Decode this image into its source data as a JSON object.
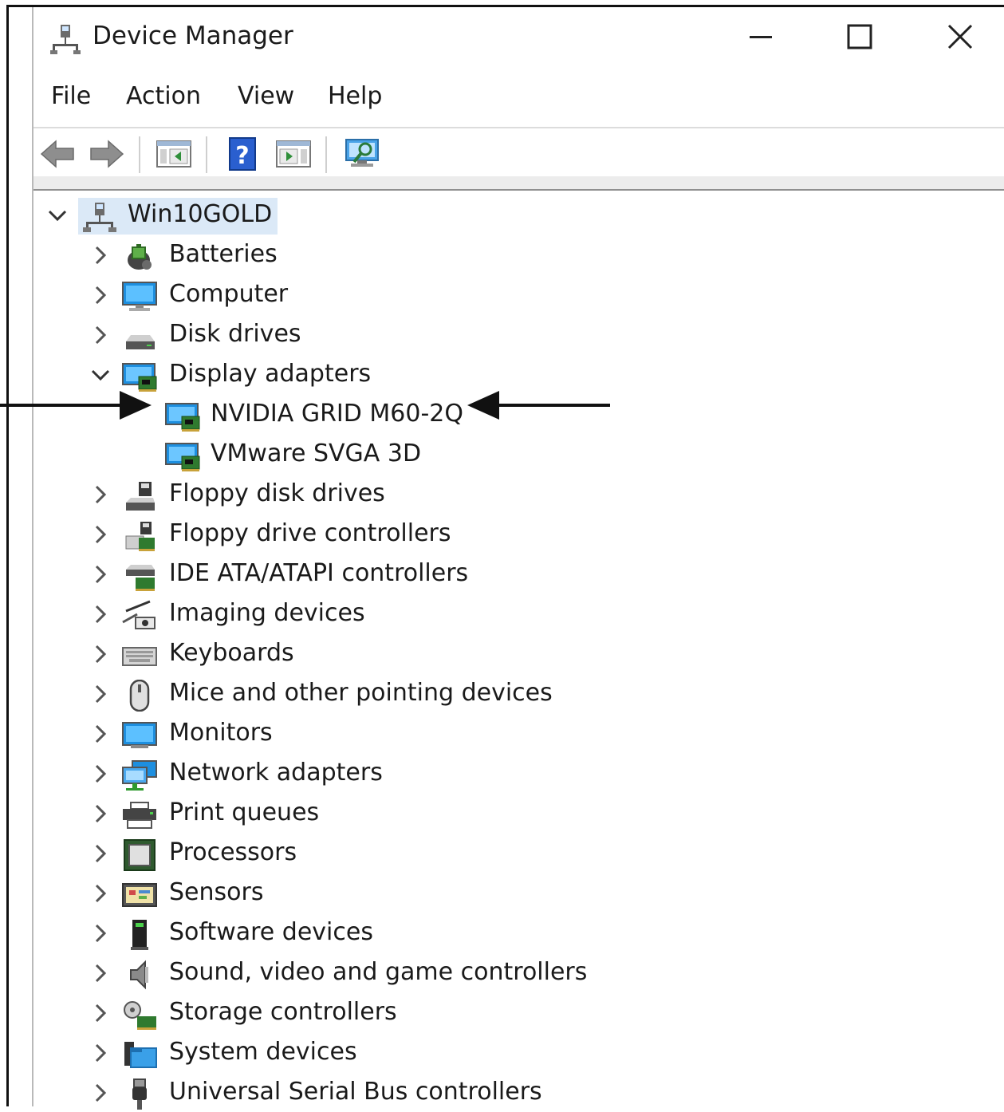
{
  "window": {
    "title": "Device Manager",
    "controls": {
      "minimize_icon": "minimize-icon",
      "maximize_icon": "maximize-icon",
      "close_icon": "close-icon"
    }
  },
  "menu": {
    "items": [
      "File",
      "Action",
      "View",
      "Help"
    ]
  },
  "toolbar": {
    "buttons": [
      "back-arrow-icon",
      "forward-arrow-icon",
      "show-hide-console-tree-icon",
      "help-icon",
      "properties-icon",
      "scan-hardware-changes-icon"
    ]
  },
  "tree": {
    "root": {
      "label": "Win10GOLD",
      "expanded": true,
      "icon": "computer-network-icon"
    },
    "categories": [
      {
        "label": "Batteries",
        "icon": "battery-icon",
        "expanded": false
      },
      {
        "label": "Computer",
        "icon": "computer-monitor-icon",
        "expanded": false
      },
      {
        "label": "Disk drives",
        "icon": "disk-drive-icon",
        "expanded": false
      },
      {
        "label": "Display adapters",
        "icon": "display-adapter-icon",
        "expanded": true,
        "children": [
          {
            "label": "NVIDIA GRID M60-2Q",
            "icon": "display-adapter-icon"
          },
          {
            "label": "VMware SVGA 3D",
            "icon": "display-adapter-icon"
          }
        ]
      },
      {
        "label": "Floppy disk drives",
        "icon": "floppy-disk-icon",
        "expanded": false
      },
      {
        "label": "Floppy drive controllers",
        "icon": "floppy-controller-icon",
        "expanded": false
      },
      {
        "label": "IDE ATA/ATAPI controllers",
        "icon": "ide-controller-icon",
        "expanded": false
      },
      {
        "label": "Imaging devices",
        "icon": "camera-icon",
        "expanded": false
      },
      {
        "label": "Keyboards",
        "icon": "keyboard-icon",
        "expanded": false
      },
      {
        "label": "Mice and other pointing devices",
        "icon": "mouse-icon",
        "expanded": false
      },
      {
        "label": "Monitors",
        "icon": "monitor-icon",
        "expanded": false
      },
      {
        "label": "Network adapters",
        "icon": "network-adapter-icon",
        "expanded": false
      },
      {
        "label": "Print queues",
        "icon": "printer-icon",
        "expanded": false
      },
      {
        "label": "Processors",
        "icon": "processor-icon",
        "expanded": false
      },
      {
        "label": "Sensors",
        "icon": "sensor-icon",
        "expanded": false
      },
      {
        "label": "Software devices",
        "icon": "software-device-icon",
        "expanded": false
      },
      {
        "label": "Sound, video and game controllers",
        "icon": "speaker-icon",
        "expanded": false
      },
      {
        "label": "Storage controllers",
        "icon": "storage-controller-icon",
        "expanded": false
      },
      {
        "label": "System devices",
        "icon": "system-folder-icon",
        "expanded": false
      },
      {
        "label": "Universal Serial Bus controllers",
        "icon": "usb-icon",
        "expanded": false
      }
    ]
  },
  "annotation": {
    "arrows": [
      "arrow-pointing-right-icon",
      "arrow-pointing-left-icon"
    ]
  },
  "colors": {
    "selection": "#dbe9f7",
    "accent": "#2a7fd4",
    "frame": "#111111"
  }
}
